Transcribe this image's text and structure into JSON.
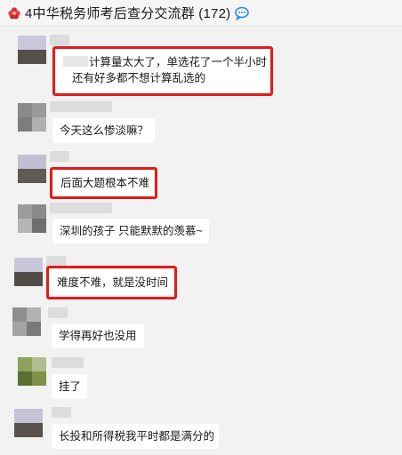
{
  "header": {
    "title": "4中华税务师考后查分交流群 (172)",
    "flower_icon": "flower-icon",
    "chat_icon": "chat-bubble-icon"
  },
  "messages": [
    {
      "lines": [
        "计算量太大了，单选花了一个半小时",
        "还有好多都不想计算乱选的"
      ],
      "highlighted": true
    },
    {
      "lines": [
        "今天这么惨淡嘛？"
      ],
      "highlighted": false
    },
    {
      "lines": [
        "后面大题根本不难"
      ],
      "highlighted": true
    },
    {
      "lines": [
        "深圳的孩子 只能默默的羡慕~"
      ],
      "highlighted": false
    },
    {
      "lines": [
        "难度不难，就是没时间"
      ],
      "highlighted": true
    },
    {
      "lines": [
        "学得再好也没用"
      ],
      "highlighted": false
    },
    {
      "lines": [
        "挂了"
      ],
      "highlighted": false
    },
    {
      "lines": [
        "长投和所得税我平时都是满分的"
      ],
      "highlighted": false
    }
  ],
  "colors": {
    "highlight": "#e21b1b",
    "bubble": "#ffffff",
    "background": "#f2f2f2"
  }
}
